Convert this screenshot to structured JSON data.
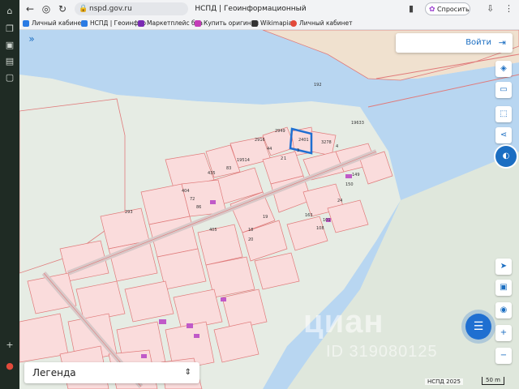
{
  "browser": {
    "url": "nspd.gov.ru",
    "page_title": "НСПД | Геоинформационный портал",
    "ask_label": "Спросить",
    "bookmarks": [
      {
        "label": "Личный кабинет",
        "color": "#2a7be4"
      },
      {
        "label": "НСПД | Геоинфор",
        "color": "#2a7be4"
      },
      {
        "label": "Маркетплейс бра",
        "color": "#7a2ab3"
      },
      {
        "label": "Купить оригинал",
        "color": "#c43cb8"
      },
      {
        "label": "Wikimapia",
        "color": "#333333"
      },
      {
        "label": "Личный кабинет",
        "color": "#e24a3b"
      }
    ]
  },
  "map": {
    "login_label": "Войти",
    "legend_label": "Легенда",
    "watermark": "циан",
    "watermark_id": "ID 319080125",
    "footer": "НСПД 2025",
    "scale_label": "50 m",
    "highlighted_parcel": "2401",
    "parcel_labels": [
      "2949",
      "2916",
      "44",
      "2401",
      "3278",
      "19514",
      "435",
      "83",
      "404",
      "72",
      "86",
      "405",
      "4",
      "3",
      "1",
      "18",
      "19",
      "163",
      "2",
      "149",
      "150",
      "24",
      "101",
      "108",
      "20",
      "19633",
      "192",
      "293"
    ],
    "colors": {
      "water": "#b8d6f1",
      "land": "#e6ece4",
      "parcel_fill": "#fadcdc",
      "parcel_stroke": "#e07a7a",
      "accent": "#1b6ec2",
      "highlight": "#1f6fd1",
      "building": "#c05ac8",
      "sand": "#f0e1cf"
    }
  },
  "toolbar_icons": [
    "layers-icon",
    "ruler-icon",
    "select-area-icon",
    "share-icon",
    "nspd-logo-icon",
    "navigate-icon",
    "minimap-icon",
    "location-icon",
    "zoom-in-icon",
    "zoom-out-icon"
  ]
}
